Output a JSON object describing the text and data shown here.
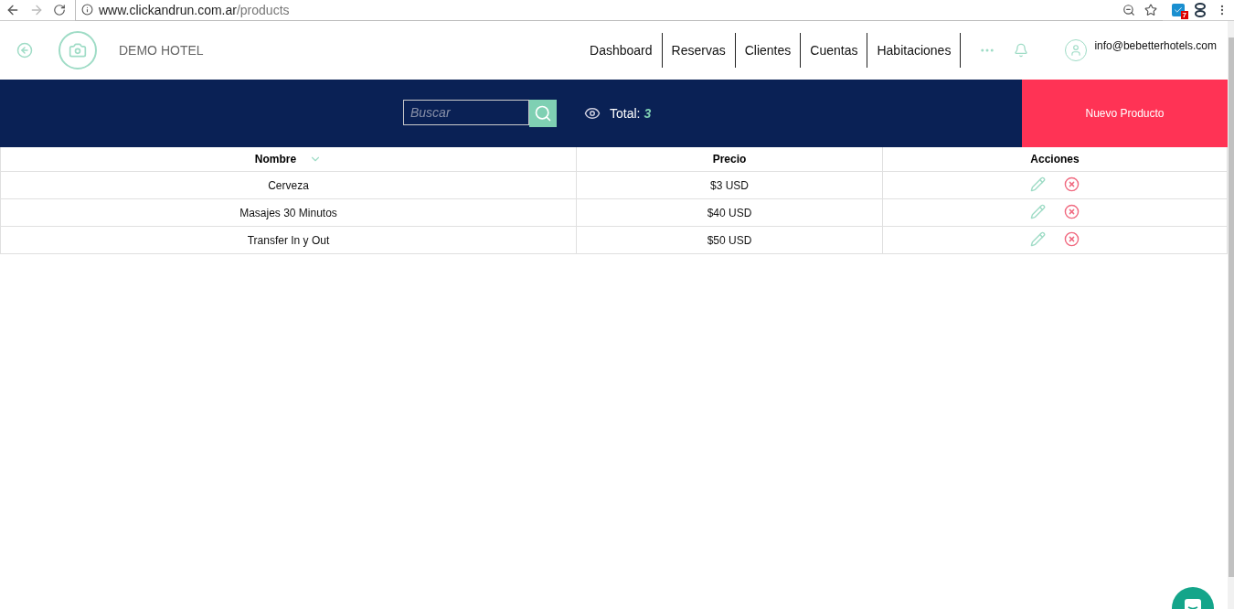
{
  "browser": {
    "url_host": "www.clickandrun.com.ar",
    "url_path": "/products",
    "extension_badge": "7"
  },
  "header": {
    "hotel_name": "DEMO HOTEL",
    "nav": [
      {
        "label": "Dashboard"
      },
      {
        "label": "Reservas"
      },
      {
        "label": "Clientes"
      },
      {
        "label": "Cuentas"
      },
      {
        "label": "Habitaciones"
      }
    ],
    "user_email": "info@bebetterhotels.com"
  },
  "toolbar": {
    "search": {
      "placeholder": "Buscar"
    },
    "total_label": "Total:",
    "total_value": "3",
    "new_button": "Nuevo Producto"
  },
  "table": {
    "columns": [
      {
        "label": "Nombre",
        "sorted": true
      },
      {
        "label": "Precio",
        "sorted": false
      },
      {
        "label": "Acciones",
        "sorted": false
      }
    ],
    "rows": [
      {
        "name": "Cerveza",
        "price": "$3 USD"
      },
      {
        "name": "Masajes 30 Minutos",
        "price": "$40 USD"
      },
      {
        "name": "Transfer In y Out",
        "price": "$50 USD"
      }
    ]
  }
}
